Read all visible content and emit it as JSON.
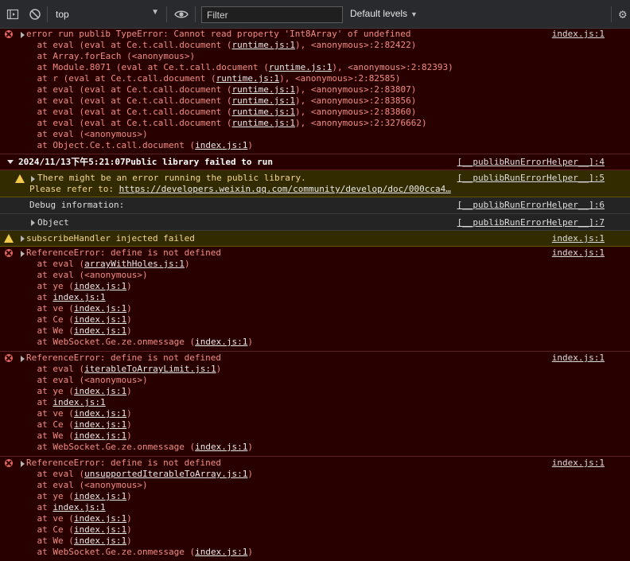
{
  "toolbar": {
    "context": "top",
    "filter_placeholder": "Filter",
    "levels": "Default levels"
  },
  "console": {
    "m1": {
      "text": "error run publib TypeError: Cannot read property 'Int8Array' of undefined",
      "source": "index.js:1",
      "stack": [
        {
          "pre": "    at eval (eval at Ce.t.call.document (",
          "link": "runtime.js:1",
          "post": "), <anonymous>:2:82422)"
        },
        {
          "pre": "    at Array.forEach (<anonymous>)",
          "link": "",
          "post": ""
        },
        {
          "pre": "    at Module.8071 (eval at Ce.t.call.document (",
          "link": "runtime.js:1",
          "post": "), <anonymous>:2:82393)"
        },
        {
          "pre": "    at r (eval at Ce.t.call.document (",
          "link": "runtime.js:1",
          "post": "), <anonymous>:2:82585)"
        },
        {
          "pre": "    at eval (eval at Ce.t.call.document (",
          "link": "runtime.js:1",
          "post": "), <anonymous>:2:83807)"
        },
        {
          "pre": "    at eval (eval at Ce.t.call.document (",
          "link": "runtime.js:1",
          "post": "), <anonymous>:2:83856)"
        },
        {
          "pre": "    at eval (eval at Ce.t.call.document (",
          "link": "runtime.js:1",
          "post": "), <anonymous>:2:83860)"
        },
        {
          "pre": "    at eval (eval at Ce.t.call.document (",
          "link": "runtime.js:1",
          "post": "), <anonymous>:2:3276662)"
        },
        {
          "pre": "    at eval (<anonymous>)",
          "link": "",
          "post": ""
        },
        {
          "pre": "    at Object.Ce.t.call.document (",
          "link": "index.js:1",
          "post": ")"
        }
      ]
    },
    "group": {
      "title": "2024/11/13下午5:21:07Public library failed to run",
      "source": "[__publibRunErrorHelper__]:4"
    },
    "warn1": {
      "line1": "There might be an error running the public library.",
      "line2_pre": "Please refer to: ",
      "line2_link": "https://developers.weixin.qq.com/community/develop/doc/000cca4…",
      "source": "[__publibRunErrorHelper__]:5"
    },
    "debug": {
      "text": "Debug information:",
      "source": "[__publibRunErrorHelper__]:6"
    },
    "object": {
      "text": "Object",
      "source": "[__publibRunErrorHelper__]:7"
    },
    "warn2": {
      "text": "subscribeHandler injected failed",
      "source": "index.js:1"
    },
    "ref1": {
      "text": "ReferenceError: define is not defined",
      "source": "index.js:1",
      "stack": [
        {
          "pre": "    at eval (",
          "link": "arrayWithHoles.js:1",
          "post": ")"
        },
        {
          "pre": "    at eval (<anonymous>)",
          "link": "",
          "post": ""
        },
        {
          "pre": "    at ye (",
          "link": "index.js:1",
          "post": ")"
        },
        {
          "pre": "    at ",
          "link": "index.js:1",
          "post": ""
        },
        {
          "pre": "    at ve (",
          "link": "index.js:1",
          "post": ")"
        },
        {
          "pre": "    at Ce (",
          "link": "index.js:1",
          "post": ")"
        },
        {
          "pre": "    at We (",
          "link": "index.js:1",
          "post": ")"
        },
        {
          "pre": "    at WebSocket.Ge.ze.onmessage (",
          "link": "index.js:1",
          "post": ")"
        }
      ]
    },
    "ref2": {
      "text": "ReferenceError: define is not defined",
      "source": "index.js:1",
      "stack": [
        {
          "pre": "    at eval (",
          "link": "iterableToArrayLimit.js:1",
          "post": ")"
        },
        {
          "pre": "    at eval (<anonymous>)",
          "link": "",
          "post": ""
        },
        {
          "pre": "    at ye (",
          "link": "index.js:1",
          "post": ")"
        },
        {
          "pre": "    at ",
          "link": "index.js:1",
          "post": ""
        },
        {
          "pre": "    at ve (",
          "link": "index.js:1",
          "post": ")"
        },
        {
          "pre": "    at Ce (",
          "link": "index.js:1",
          "post": ")"
        },
        {
          "pre": "    at We (",
          "link": "index.js:1",
          "post": ")"
        },
        {
          "pre": "    at WebSocket.Ge.ze.onmessage (",
          "link": "index.js:1",
          "post": ")"
        }
      ]
    },
    "ref3": {
      "text": "ReferenceError: define is not defined",
      "source": "index.js:1",
      "stack": [
        {
          "pre": "    at eval (",
          "link": "unsupportedIterableToArray.js:1",
          "post": ")"
        },
        {
          "pre": "    at eval (<anonymous>)",
          "link": "",
          "post": ""
        },
        {
          "pre": "    at ye (",
          "link": "index.js:1",
          "post": ")"
        },
        {
          "pre": "    at ",
          "link": "index.js:1",
          "post": ""
        },
        {
          "pre": "    at ve (",
          "link": "index.js:1",
          "post": ")"
        },
        {
          "pre": "    at Ce (",
          "link": "index.js:1",
          "post": ")"
        },
        {
          "pre": "    at We (",
          "link": "index.js:1",
          "post": ")"
        },
        {
          "pre": "    at WebSocket.Ge.ze.onmessage (",
          "link": "index.js:1",
          "post": ")"
        }
      ]
    }
  }
}
